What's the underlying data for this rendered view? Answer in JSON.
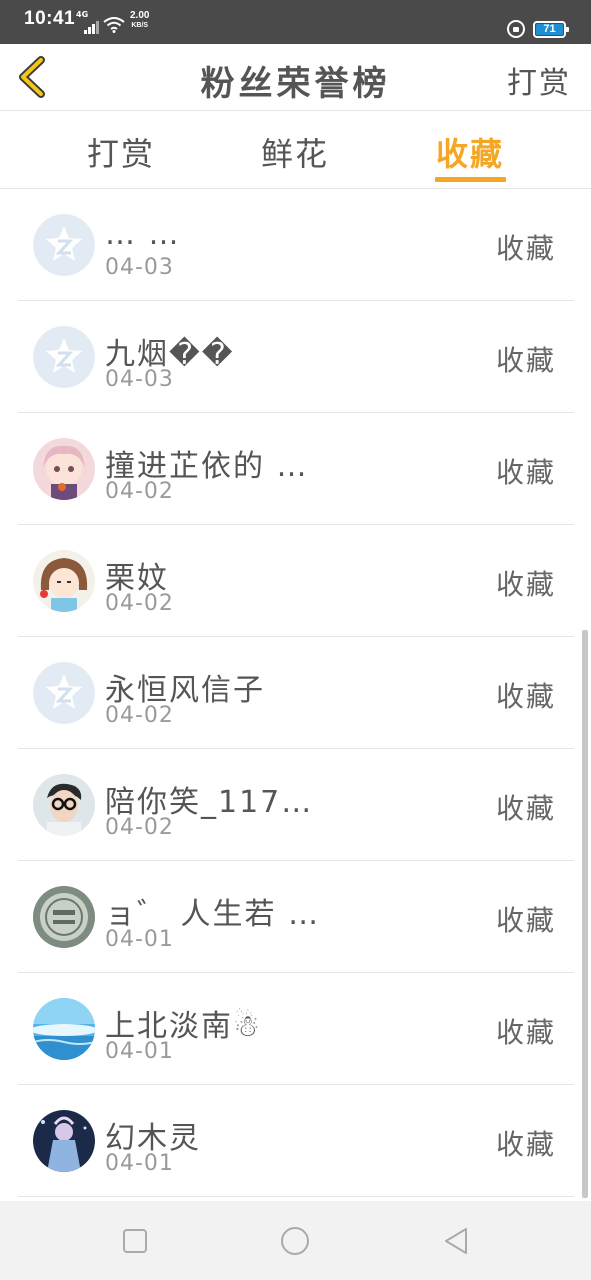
{
  "status_bar": {
    "time": "10:41",
    "network": "4G",
    "speed_value": "2.00",
    "speed_unit": "KB/S",
    "battery": "71",
    "battery_level": 0.71,
    "battery_color": "#1e8fd1"
  },
  "header": {
    "title": "粉丝荣誉榜",
    "right_link": "打赏",
    "back_icon": "chevron-left-icon",
    "accent_color": "#f5a623"
  },
  "tabs": [
    {
      "label": "打赏",
      "active": false
    },
    {
      "label": "鲜花",
      "active": false
    },
    {
      "label": "收藏",
      "active": true
    }
  ],
  "list": [
    {
      "name": "… …",
      "date": "04-03",
      "action": "收藏",
      "avatar": "default-avatar-icon"
    },
    {
      "name": "九烟��",
      "date": "04-03",
      "action": "收藏",
      "avatar": "default-avatar-icon"
    },
    {
      "name": "撞进芷依的 …",
      "date": "04-02",
      "action": "收藏",
      "avatar": "anime-girl-avatar"
    },
    {
      "name": "栗妏",
      "date": "04-02",
      "action": "收藏",
      "avatar": "cartoon-girl-avatar"
    },
    {
      "name": "永恒风信子",
      "date": "04-02",
      "action": "收藏",
      "avatar": "default-avatar-icon"
    },
    {
      "name": "陪你笑_117…",
      "date": "04-02",
      "action": "收藏",
      "avatar": "boy-glasses-avatar"
    },
    {
      "name": "ョ゛ 人生若 …",
      "date": "04-01",
      "action": "收藏",
      "avatar": "coin-avatar"
    },
    {
      "name": "上北淡南☃",
      "date": "04-01",
      "action": "收藏",
      "avatar": "sky-avatar"
    },
    {
      "name": "幻木灵",
      "date": "04-01",
      "action": "收藏",
      "avatar": "fantasy-avatar"
    }
  ],
  "nav_bar": {
    "recent_icon": "square-icon",
    "home_icon": "circle-icon",
    "back_icon": "triangle-back-icon"
  }
}
